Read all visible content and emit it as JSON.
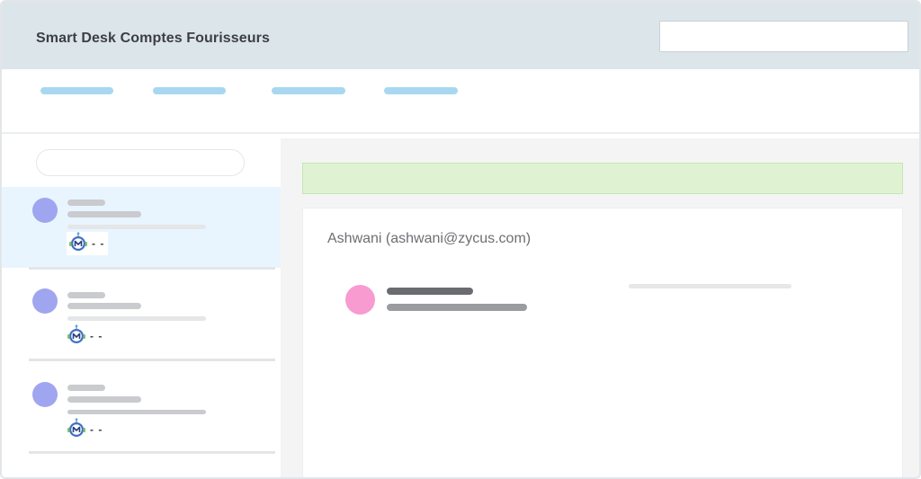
{
  "header": {
    "title": "Smart Desk Comptes Fourisseurs",
    "search_value": ""
  },
  "sidebar": {
    "search_value": "",
    "items": [
      {
        "meta_text": "- -",
        "icon": "merlin-bot-icon",
        "active": true
      },
      {
        "meta_text": "- -",
        "icon": "merlin-bot-icon",
        "active": false
      },
      {
        "meta_text": "- -",
        "icon": "merlin-bot-icon",
        "active": false
      }
    ]
  },
  "main": {
    "contact": "Ashwani (ashwani@zycus.com)"
  },
  "colors": {
    "header_bg": "#dce5ea",
    "nav_pill": "#a8d8f0",
    "active_item_bg": "#e9f5fe",
    "avatar": "#a0a5f0",
    "banner_bg": "#dff3d2",
    "contact_avatar": "#f79bd0"
  }
}
